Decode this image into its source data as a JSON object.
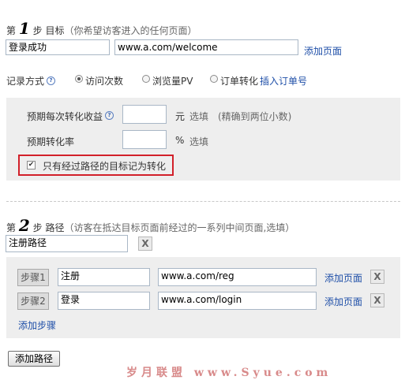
{
  "step1": {
    "prefix": "第",
    "number": "1",
    "word": "步",
    "title": "目标",
    "hint": "（你希望访客进入的任何页面）",
    "name_value": "登录成功",
    "url_value": "www.a.com/welcome",
    "add_page_label": "添加页面"
  },
  "record": {
    "label": "记录方式",
    "options": [
      "访问次数",
      "浏览量PV",
      "订单转化"
    ],
    "selected": "访问次数",
    "insert_order_label": "插入订单号"
  },
  "conversion": {
    "revenue_label": "预期每次转化收益",
    "revenue_value": "",
    "revenue_unit": "元",
    "revenue_note": "选填　(精确到两位小数)",
    "rate_label": "预期转化率",
    "rate_value": "",
    "rate_unit": "%",
    "rate_note": "选填",
    "only_path_label": "只有经过路径的目标记为转化",
    "only_path_checked": true
  },
  "step2": {
    "prefix": "第",
    "number": "2",
    "word": "步",
    "title": "路径",
    "hint": "（访客在抵达目标页面前经过的一系列中间页面,选填）",
    "path_name_value": "注册路径",
    "close_label": "X",
    "steps": [
      {
        "label": "步骤1",
        "name_value": "注册",
        "url_value": "www.a.com/reg",
        "add_page_label": "添加页面",
        "close_label": "X"
      },
      {
        "label": "步骤2",
        "name_value": "登录",
        "url_value": "www.a.com/login",
        "add_page_label": "添加页面",
        "close_label": "X"
      }
    ],
    "add_step_label": "添加步骤"
  },
  "add_path_button": "添加路径",
  "watermark": "岁月联盟 www.Syue.com"
}
